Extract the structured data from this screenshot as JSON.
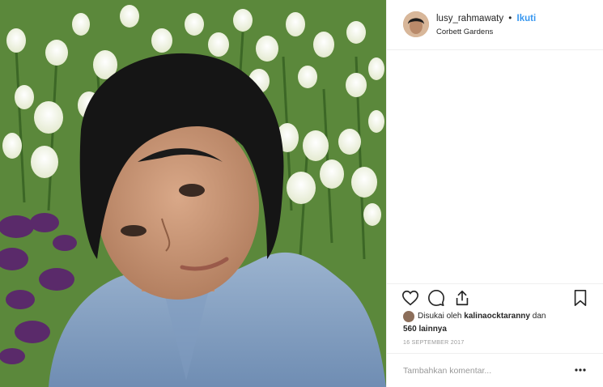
{
  "post": {
    "username": "lusy_rahmawaty",
    "separator": "•",
    "follow_label": "Ikuti",
    "location": "Corbett Gardens",
    "photo_alt": "selfie-with-tulips"
  },
  "actions": {
    "like": "heart-icon",
    "comment": "comment-icon",
    "share": "share-icon",
    "save": "bookmark-icon"
  },
  "likes": {
    "prefix": "Disukai oleh",
    "liker": "kalinaocktaranny",
    "conj": "dan",
    "count_text": "560 lainnya"
  },
  "date": "16 SEPTEMBER 2017",
  "comment": {
    "placeholder": "Tambahkan komentar...",
    "more": "more-icon"
  },
  "colors": {
    "accent": "#3897f0",
    "text": "#262626",
    "muted": "#999999",
    "divider": "#efefef"
  }
}
